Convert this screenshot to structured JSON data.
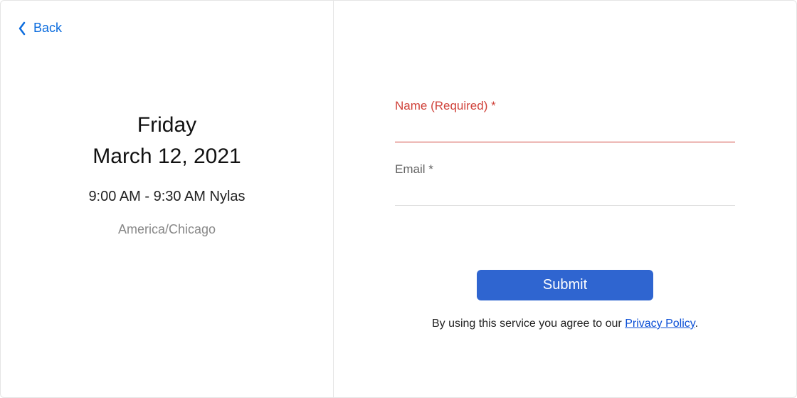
{
  "back": {
    "label": "Back"
  },
  "event": {
    "day_name": "Friday",
    "date_full": "March 12, 2021",
    "time_slot": "9:00 AM - 9:30 AM Nylas",
    "timezone": "America/Chicago"
  },
  "form": {
    "name": {
      "label": "Name (Required) *",
      "value": "",
      "error": true
    },
    "email": {
      "label": "Email *",
      "value": "",
      "error": false
    },
    "submit_label": "Submit"
  },
  "footer": {
    "agreement_prefix": "By using this service you agree to our ",
    "privacy_link_text": "Privacy Policy",
    "agreement_suffix": "."
  }
}
